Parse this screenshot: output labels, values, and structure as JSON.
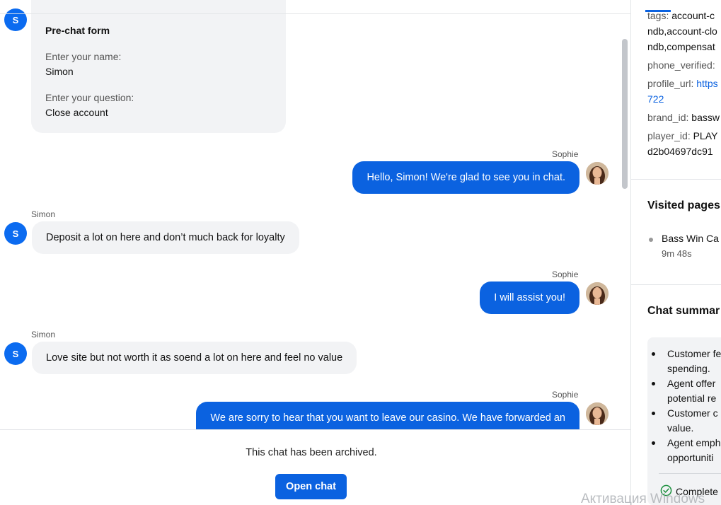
{
  "chat": {
    "prechat_form": {
      "title": "Pre-chat form",
      "name_label": "Enter your name:",
      "name_value": "Simon",
      "question_label": "Enter your question:",
      "question_value": "Close account"
    },
    "customer_initial": "S",
    "messages": [
      {
        "sender": "Sophie",
        "text": "Hello, Simon! We're glad to see you in chat."
      },
      {
        "sender": "Simon",
        "text": "Deposit a lot on here and don’t much back for loyalty"
      },
      {
        "sender": "Sophie",
        "text": "I will assist you!"
      },
      {
        "sender": "Simon",
        "text": "Love site but not worth it as soend a lot on here and feel no value"
      },
      {
        "sender": "Sophie",
        "text": "We are sorry to hear that you want to leave our casino. We have forwarded an"
      }
    ],
    "archived_text": "This chat has been archived.",
    "open_chat_label": "Open chat"
  },
  "details": {
    "tags_key": "tags:",
    "tags_value_1": "account-c",
    "tags_value_2": "ndb,account-clo",
    "tags_value_3": "ndb,compensat",
    "phone_verified_key": "phone_verified:",
    "profile_url_key": "profile_url:",
    "profile_url_value_1": "https",
    "profile_url_value_2": "722",
    "brand_id_key": "brand_id:",
    "brand_id_value": "bassw",
    "player_id_key": "player_id:",
    "player_id_value_1": "PLAY",
    "player_id_value_2": "d2b04697dc91"
  },
  "visited_pages": {
    "heading": "Visited pages",
    "items": [
      {
        "title": "Bass Win Ca",
        "duration": "9m 48s"
      }
    ]
  },
  "chat_summary": {
    "heading": "Chat summar",
    "bullets": [
      {
        "line1": "Customer fe",
        "line2": "spending."
      },
      {
        "line1": "Agent offer",
        "line2": "potential re"
      },
      {
        "line1": "Customer c",
        "line2": "value."
      },
      {
        "line1": "Agent emph",
        "line2": "opportuniti"
      }
    ],
    "status": "Complete"
  },
  "watermark": "Активация Windows",
  "colors": {
    "accent": "#0b62e0",
    "bubble_in": "#f2f3f5",
    "avatar": "#0b6bf0"
  }
}
